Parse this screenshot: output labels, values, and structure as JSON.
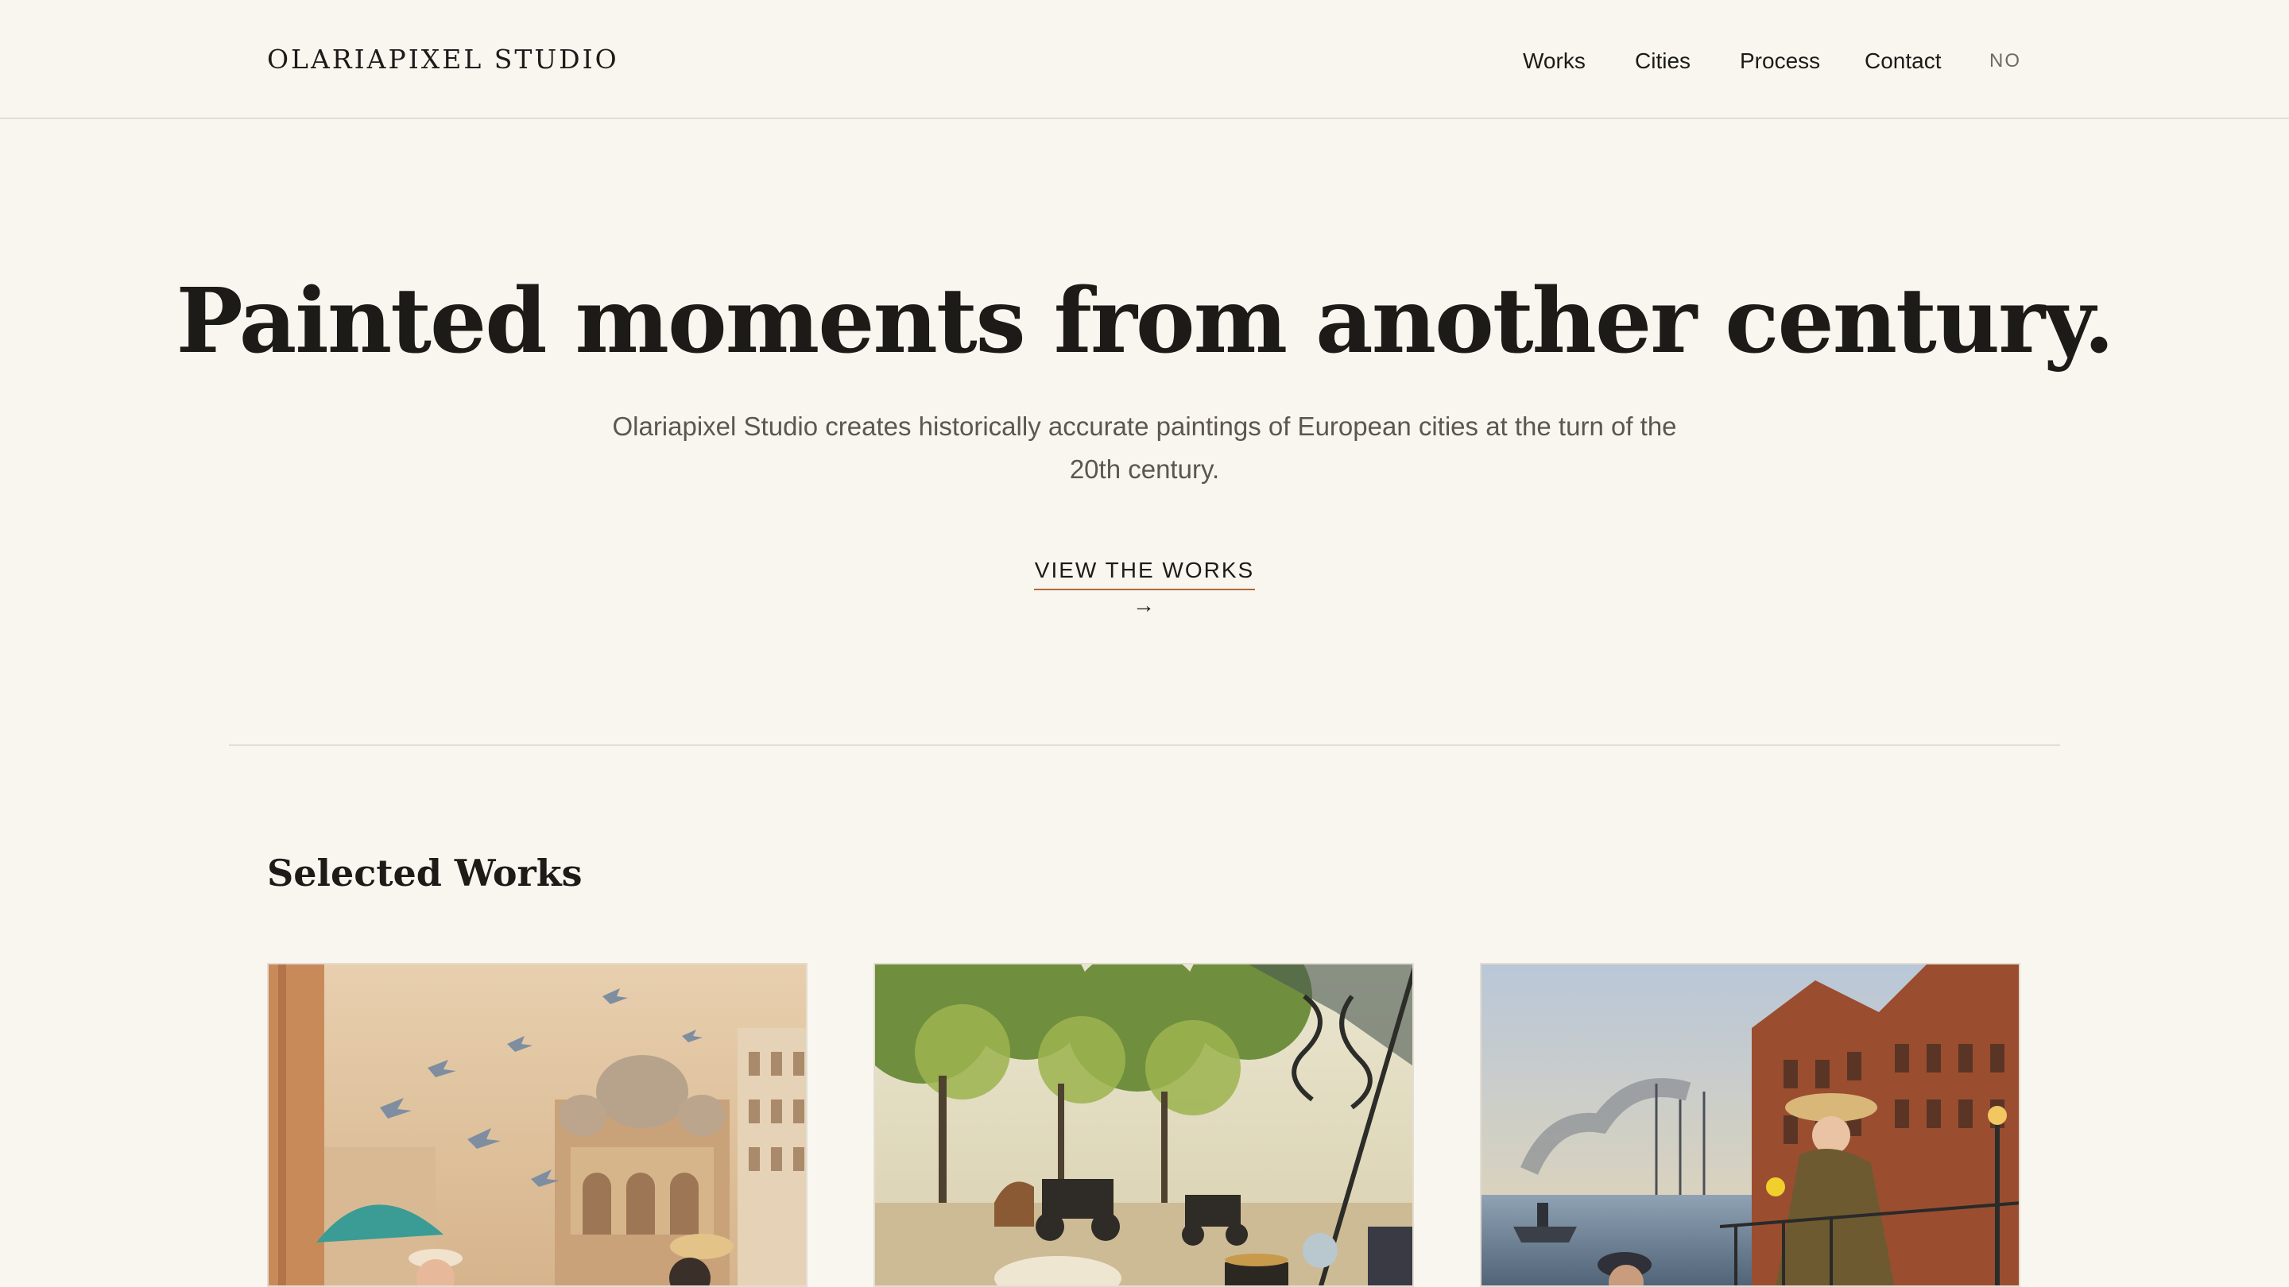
{
  "header": {
    "brand": "OLARIAPIXEL STUDIO",
    "nav": [
      {
        "label": "Works"
      },
      {
        "label": "Cities"
      },
      {
        "label": "Process"
      },
      {
        "label": "Contact"
      },
      {
        "label": "NO"
      }
    ]
  },
  "hero": {
    "title": "Painted moments from another century.",
    "subtitle": "Olariapixel Studio creates historically accurate paintings of European cities at the turn of the 20th century.",
    "cta": "VIEW THE WORKS →"
  },
  "works": {
    "title": "Selected Works",
    "items": [
      {
        "subject": "venice-piazza-painting"
      },
      {
        "subject": "paris-boulevard-painting"
      },
      {
        "subject": "hamburg-harbour-painting"
      }
    ]
  },
  "colors": {
    "background": "#f9f6f0",
    "text": "#1d1b18",
    "muted": "#5c564e",
    "accent": "#b06a3a",
    "divider": "#e3ddd3"
  }
}
